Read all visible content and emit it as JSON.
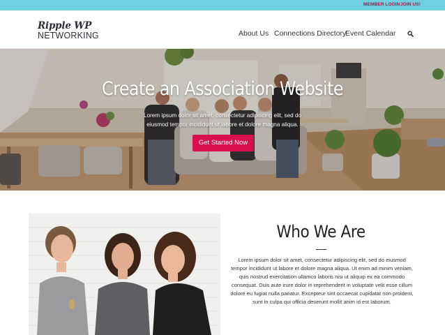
{
  "topbar": {
    "member_login": "MEMBER LOGIN",
    "join": "JOIN US!"
  },
  "logo": {
    "line1": "Ripple WP",
    "line2": "NETWORKING"
  },
  "nav": {
    "about": "About Us",
    "connections": "Connections Directory",
    "events": "Event Calendar",
    "search_icon": "search-icon"
  },
  "hero": {
    "title": "Create an Association Website",
    "subtitle": "Lorem ipsum dolor sit amet, consectetur adipiscing elit, sed do eiusmod tempor incididunt ut labore et dolore magna aliqua.",
    "button": "Get Started Now"
  },
  "who": {
    "title": "Who We Are",
    "body": "Lorem ipsum dolor sit amet, consectetur adipiscing elit, sed do eiusmod tempor incididunt ut labore et dolore magna aliqua. Ut enim ad minim veniam, quis nostrud exercitation ullamco laboris nisi ut aliquip ex ea commodo consequat. Duis aute irure dolor in reprehenderit in voluptate velit esse cillum dolore eu fugiat nulla pariatur. Excepteur sint occaecat cupidatat non proident, sunt in culpa qui officia deserunt mollit anim id est laborum."
  },
  "colors": {
    "topbar": "#6ed0e0",
    "accent": "#d8104f",
    "topbar_link": "#b0134a"
  }
}
